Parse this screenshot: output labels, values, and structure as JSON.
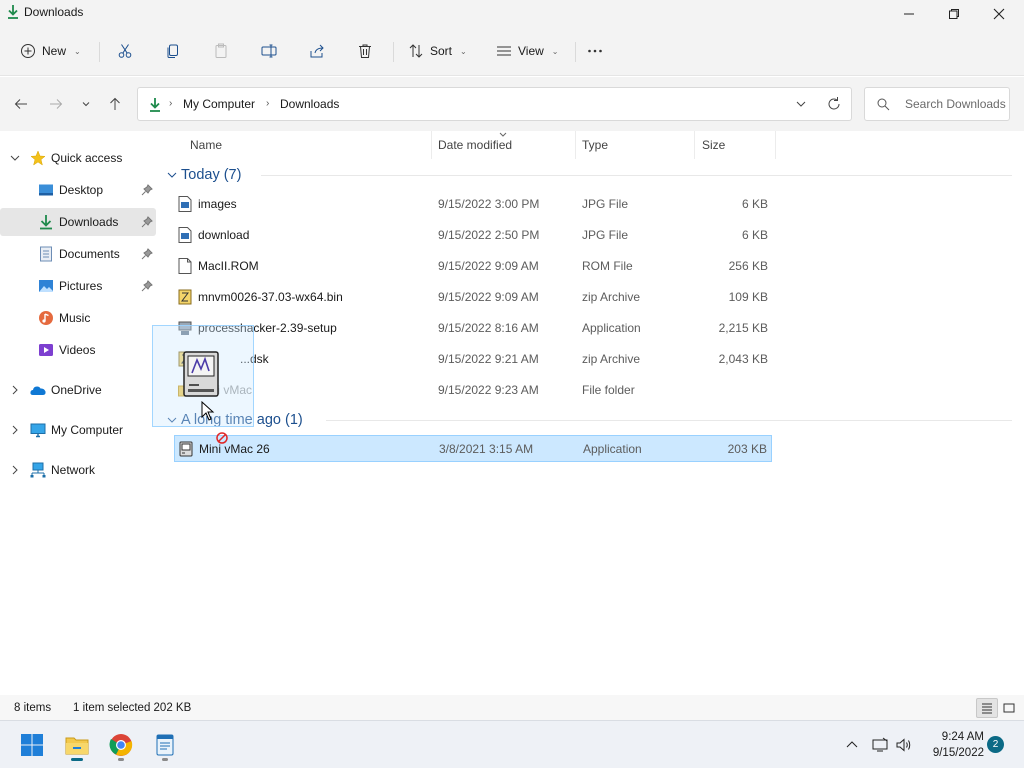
{
  "window": {
    "title": "Downloads",
    "controls": {
      "minimize": "minimize",
      "maximize": "maximize",
      "close": "close"
    }
  },
  "toolbar": {
    "new_label": "New",
    "sort_label": "Sort",
    "view_label": "View",
    "icons": [
      "cut-icon",
      "copy-icon",
      "paste-icon",
      "rename-icon",
      "share-icon",
      "delete-icon",
      "more-icon"
    ]
  },
  "address": {
    "crumbs": [
      "My Computer",
      "Downloads"
    ]
  },
  "search": {
    "placeholder": "Search Downloads"
  },
  "sidebar": {
    "quick_access": "Quick access",
    "items": [
      {
        "label": "Desktop",
        "icon": "desktop-icon",
        "pinned": true
      },
      {
        "label": "Downloads",
        "icon": "download-icon",
        "pinned": true,
        "selected": true
      },
      {
        "label": "Documents",
        "icon": "documents-icon",
        "pinned": true
      },
      {
        "label": "Pictures",
        "icon": "pictures-icon",
        "pinned": true
      },
      {
        "label": "Music",
        "icon": "music-icon",
        "pinned": false
      },
      {
        "label": "Videos",
        "icon": "videos-icon",
        "pinned": false
      }
    ],
    "roots": [
      {
        "label": "OneDrive",
        "icon": "onedrive-icon"
      },
      {
        "label": "My Computer",
        "icon": "computer-icon"
      },
      {
        "label": "Network",
        "icon": "network-icon"
      }
    ]
  },
  "columns": {
    "name": "Name",
    "date": "Date modified",
    "type": "Type",
    "size": "Size"
  },
  "groups": [
    {
      "label": "Today (7)",
      "files": [
        {
          "name": "images",
          "date": "9/15/2022 3:00 PM",
          "type": "JPG File",
          "size": "6 KB",
          "icon": "image-file-icon"
        },
        {
          "name": "download",
          "date": "9/15/2022 2:50 PM",
          "type": "JPG File",
          "size": "6 KB",
          "icon": "image-file-icon"
        },
        {
          "name": "MacII.ROM",
          "date": "9/15/2022 9:09 AM",
          "type": "ROM File",
          "size": "256 KB",
          "icon": "blank-file-icon"
        },
        {
          "name": "mnvm0026-37.03-wx64.bin",
          "date": "9/15/2022 9:09 AM",
          "type": "zip Archive",
          "size": "109 KB",
          "icon": "zip-file-icon"
        },
        {
          "name": "processhacker-2.39-setup",
          "date": "9/15/2022 8:16 AM",
          "type": "Application",
          "size": "2,215 KB",
          "icon": "setup-app-icon"
        },
        {
          "name": "...dsk",
          "date": "9/15/2022 9:21 AM",
          "type": "zip Archive",
          "size": "2,043 KB",
          "icon": "zip-file-icon"
        },
        {
          "name": "Mini vMac",
          "date": "9/15/2022 9:23 AM",
          "type": "File folder",
          "size": "",
          "icon": "folder-icon"
        }
      ]
    },
    {
      "label": "A long time ago (1)",
      "files": [
        {
          "name": "Mini vMac 26",
          "date": "3/8/2021 3:15 AM",
          "type": "Application",
          "size": "203 KB",
          "icon": "minivmac-app-icon",
          "selected": true
        }
      ]
    }
  ],
  "status": {
    "count": "8 items",
    "selection": "1 item selected  202 KB"
  },
  "taskbar": {
    "apps": [
      "start-icon",
      "file-explorer-icon",
      "chrome-icon",
      "notepad-icon"
    ],
    "time": "9:24 AM",
    "date": "9/15/2022",
    "notifications": "2"
  },
  "colors": {
    "accent": "#0b6a86",
    "selection_bg": "#cce8ff",
    "group_header": "#1c4f8e",
    "download_green": "#1f8a4c"
  }
}
